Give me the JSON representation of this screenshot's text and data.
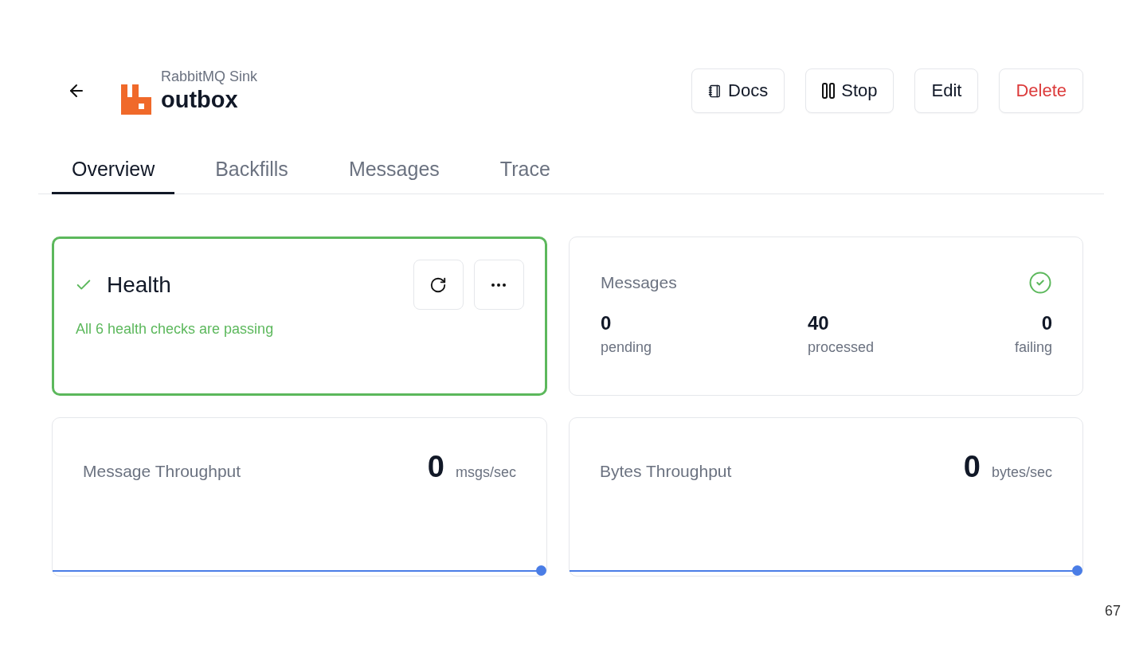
{
  "header": {
    "subtitle": "RabbitMQ Sink",
    "title": "outbox",
    "actions": [
      {
        "kind": "docs",
        "label": "Docs"
      },
      {
        "kind": "stop",
        "label": "Stop"
      },
      {
        "kind": "plain",
        "label": "Edit"
      },
      {
        "kind": "danger",
        "label": "Delete"
      }
    ]
  },
  "tabs": [
    {
      "label": "Overview",
      "selected": true
    },
    {
      "label": "Backfills",
      "selected": false
    },
    {
      "label": "Messages",
      "selected": false
    },
    {
      "label": "Trace",
      "selected": false
    }
  ],
  "health": {
    "title": "Health",
    "passing": true,
    "summary": "All 6 health checks are passing"
  },
  "messages": {
    "title": "Messages",
    "healthy": true,
    "stats": [
      {
        "value": "0",
        "label": "pending"
      },
      {
        "value": "40",
        "label": "processed"
      },
      {
        "value": "0",
        "label": "failing"
      }
    ]
  },
  "throughput": [
    {
      "title": "Message Throughput",
      "value": "0",
      "unit": "msgs/sec"
    },
    {
      "title": "Bytes Throughput",
      "value": "0",
      "unit": "bytes/sec"
    }
  ],
  "page_number": "67"
}
